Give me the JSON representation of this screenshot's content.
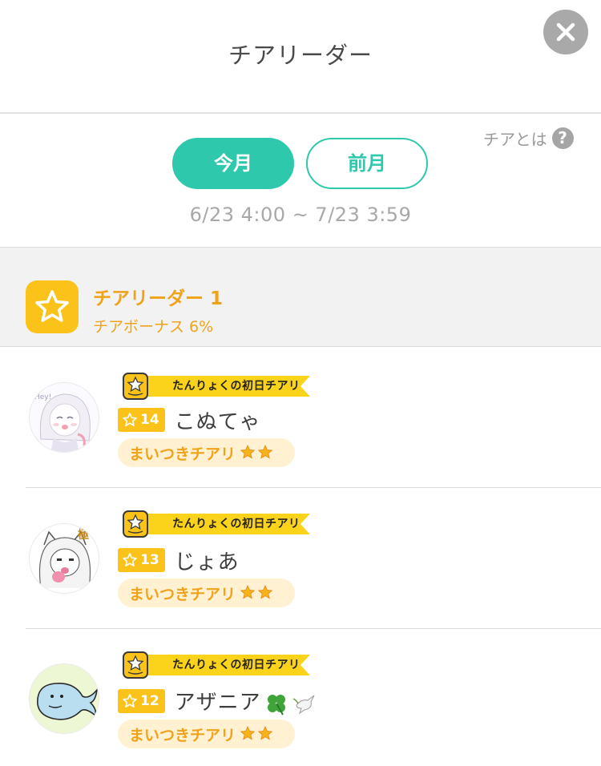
{
  "header": {
    "title": "チアリーダー"
  },
  "info_link": {
    "label": "チアとは",
    "help_glyph": "?"
  },
  "tabs": [
    {
      "label": "今月",
      "selected": true
    },
    {
      "label": "前月",
      "selected": false
    }
  ],
  "period": "6/23 4:00 ~ 7/23 3:59",
  "rank": {
    "title": "チアリーダー 1",
    "bonus": "チアボーナス 6%"
  },
  "users": [
    {
      "banner": "たんりょくの初日チアリ",
      "level": "14",
      "name": "こぬてゃ",
      "title": "まいつきチアリ",
      "avatar": "white-hair-girl-avatar"
    },
    {
      "banner": "たんりょくの初日チアリ",
      "level": "13",
      "name": "じょあ",
      "title": "まいつきチアリ",
      "avatar": "cat-ear-girl-avatar"
    },
    {
      "banner": "たんりょくの初日チアリ",
      "level": "12",
      "name": "アザニア",
      "title": "まいつきチアリ",
      "avatar": "whale-avatar"
    }
  ],
  "colors": {
    "accent": "#2ec8ad",
    "gold": "#fbc31a",
    "orange": "#f0a21a",
    "pill": "#fff1d2"
  }
}
